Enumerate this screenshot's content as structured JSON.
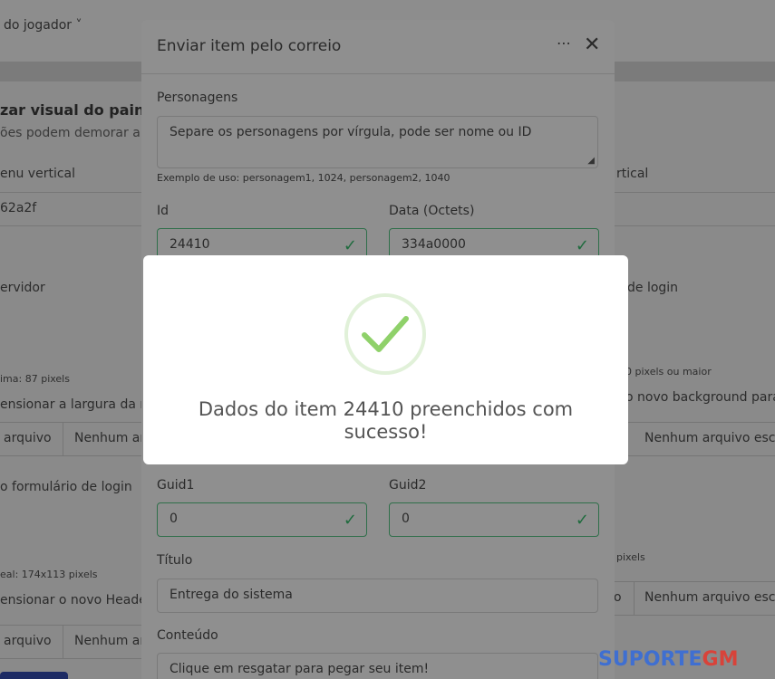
{
  "background": {
    "topbar_menu": "do jogador ˅",
    "section_title": "zar visual do painel",
    "section_subtitle": "ões podem demorar al",
    "col_left_header": "enu vertical",
    "col_right_header": "rtical",
    "color_value": "62a2f",
    "label_servidor": "ervidor",
    "label_login": "de login",
    "hint_left": "ima: 87 pixels",
    "hint_right": "0 pixels ou maior",
    "label_dimensionar": "ensionar a largura da n",
    "label_background": "o novo background para",
    "file_btn_left": "arquivo",
    "file_none_left": "Nenhum ar",
    "file_none_right": "Nenhum arquivo esco",
    "label_form_login": "o formulário de login",
    "hint_left2": "eal: 174x113 pixels",
    "hint_right2": "pixels",
    "label_header": "ensionar o novo Header",
    "file_btn_right2": "o",
    "file_none_right2": "Nenhum arquivo esco",
    "file_btn_left3": "arquivo",
    "file_none_left3": "Nenhum ar"
  },
  "modal": {
    "title": "Enviar item pelo correio",
    "more_icon": "⋯",
    "close_icon": "✕",
    "personagens_label": "Personagens",
    "personagens_placeholder": "Separe os personagens por vírgula, pode ser nome ou ID",
    "personagens_help": "Exemplo de uso: personagem1, 1024, personagem2, 1040",
    "id_label": "Id",
    "id_value": "24410",
    "data_label": "Data (Octets)",
    "data_value": "334a0000",
    "guid1_label": "Guid1",
    "guid1_value": "0",
    "guid2_label": "Guid2",
    "guid2_value": "0",
    "titulo_label": "Título",
    "titulo_value": "Entrega do sistema",
    "conteudo_label": "Conteúdo",
    "conteudo_value": "Clique em resgatar para pegar seu item!",
    "valid_icon": "✓"
  },
  "alert": {
    "message": "Dados do item 24410 preenchidos com sucesso!",
    "icon": "success-check",
    "icon_color": "#8fd16a",
    "ring_color": "#e1f1d9"
  },
  "watermark": {
    "part1": "SUPORTE",
    "part2": "GM"
  }
}
